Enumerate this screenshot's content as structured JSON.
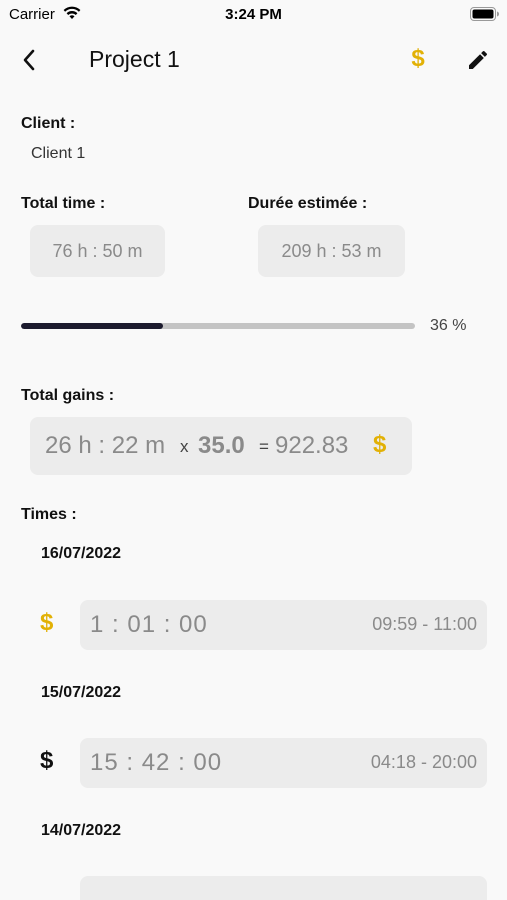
{
  "status_bar": {
    "carrier": "Carrier",
    "time": "3:24 PM"
  },
  "nav": {
    "title": "Project 1",
    "dollar_icon": "$"
  },
  "client": {
    "label": "Client :",
    "value": "Client 1"
  },
  "total_time": {
    "label": "Total time :",
    "value": "76 h : 50 m"
  },
  "estimated": {
    "label": "Durée estimée :",
    "value": "209 h : 53 m"
  },
  "progress": {
    "fraction": 0.36,
    "text": "36 %"
  },
  "gains": {
    "label": "Total gains :",
    "time": "26 h : 22 m",
    "times_sign": "x",
    "rate": "35.0",
    "equals_sign": "=",
    "total": "922.83",
    "currency": "$"
  },
  "times": {
    "label": "Times :",
    "entries": [
      {
        "date": "16/07/2022",
        "billable_icon": "$",
        "duration": "1 : 01 : 00",
        "range": "09:59 - 11:00",
        "icon_color": "#e2b106"
      },
      {
        "date": "15/07/2022",
        "billable_icon": "$",
        "duration": "15 : 42 : 00",
        "range": "04:18 - 20:00",
        "icon_color": "#111111"
      },
      {
        "date": "14/07/2022"
      }
    ]
  },
  "colors": {
    "accent_gold": "#e2b106",
    "progress_dark": "#1c1b2e",
    "chip_bg": "#ececec"
  }
}
